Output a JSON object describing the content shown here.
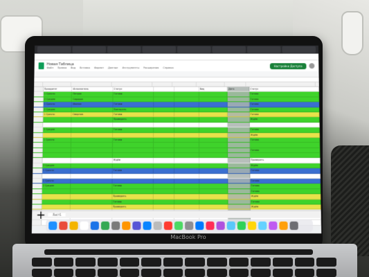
{
  "scene": {
    "laptop_label": "MacBook Pro"
  },
  "sheet": {
    "doc_title": "Новая Таблица",
    "menu": [
      "Файл",
      "Правка",
      "Вид",
      "Вставка",
      "Формат",
      "Данные",
      "Инструменты",
      "Расширения",
      "Справка"
    ],
    "share_label": "Настройки Доступа",
    "sheet_tab": "Лист1",
    "row_colors": [
      "#ffffff",
      "#3fd32b",
      "#3fd32b",
      "#3a6fd0",
      "#3fd32b",
      "#e8e24a",
      "#3fd32b",
      "#ffffff",
      "#3fd32b",
      "#e8e24a",
      "#3fd32b",
      "#3fd32b",
      "#3fd32b",
      "#3fd32b",
      "#ffffff",
      "#3fd32b",
      "#3a6fd0",
      "#ffffff",
      "#3a6fd0",
      "#3fd32b",
      "#3fd32b",
      "#e8e24a",
      "#3fd32b",
      "#e8e24a",
      "#ffffff",
      "#ffffff",
      "#ffffff"
    ],
    "cells": [
      [
        "Приоритет",
        "Исполнитель",
        "Статус",
        "Вид",
        "Дата",
        "Статус"
      ],
      [
        "1 Срочно",
        "Петров",
        "Готово",
        "",
        "",
        "Готово"
      ],
      [
        "2 Средне",
        "Сидоров",
        "",
        "",
        "",
        "Готово"
      ],
      [
        "1 Срочно",
        "Иванов",
        "Готово",
        "",
        "",
        "Готово"
      ],
      [
        "2 Средне",
        "",
        "Повторить",
        "",
        "",
        "Готово"
      ],
      [
        "1 Срочно",
        "Смирнов",
        "Готово",
        "",
        "",
        "Готово"
      ],
      [
        "",
        "",
        "Проверить",
        "",
        "",
        "Ждём"
      ],
      [
        "",
        "",
        "",
        "",
        "",
        ""
      ],
      [
        "2 Средне",
        "",
        "Готово",
        "",
        "",
        "Готово"
      ],
      [
        "",
        "",
        "",
        "",
        "",
        "Ждём"
      ],
      [
        "1 Срочно",
        "",
        "Готово",
        "",
        "",
        "Готово"
      ],
      [
        "",
        "",
        "",
        "",
        "",
        ""
      ],
      [
        "",
        "",
        "",
        "",
        "",
        "Готово"
      ],
      [
        "",
        "",
        "",
        "",
        "",
        ""
      ],
      [
        "",
        "",
        "Ждём",
        "",
        "",
        "Проверить"
      ],
      [
        "2 Средне",
        "",
        "",
        "",
        "",
        "Ждём"
      ],
      [
        "1 Срочно",
        "",
        "Готово",
        "",
        "",
        "Готово"
      ],
      [
        "",
        "",
        "",
        "",
        "",
        ""
      ],
      [
        "1 Срочно",
        "",
        "",
        "",
        "",
        "Готово"
      ],
      [
        "2 Средне",
        "",
        "Готово",
        "",
        "",
        "Готово"
      ],
      [
        "",
        "",
        "",
        "",
        "",
        "Готово"
      ],
      [
        "",
        "",
        "Проверить",
        "",
        "",
        "Ждём"
      ],
      [
        "",
        "",
        "Готово",
        "",
        "",
        "Готово"
      ],
      [
        "",
        "",
        "Проверить",
        "",
        "",
        "Ждём"
      ],
      [
        "",
        "",
        "",
        "",
        "",
        ""
      ],
      [
        "",
        "",
        "",
        "",
        "",
        ""
      ],
      [
        "",
        "",
        "",
        "",
        "",
        ""
      ]
    ]
  }
}
